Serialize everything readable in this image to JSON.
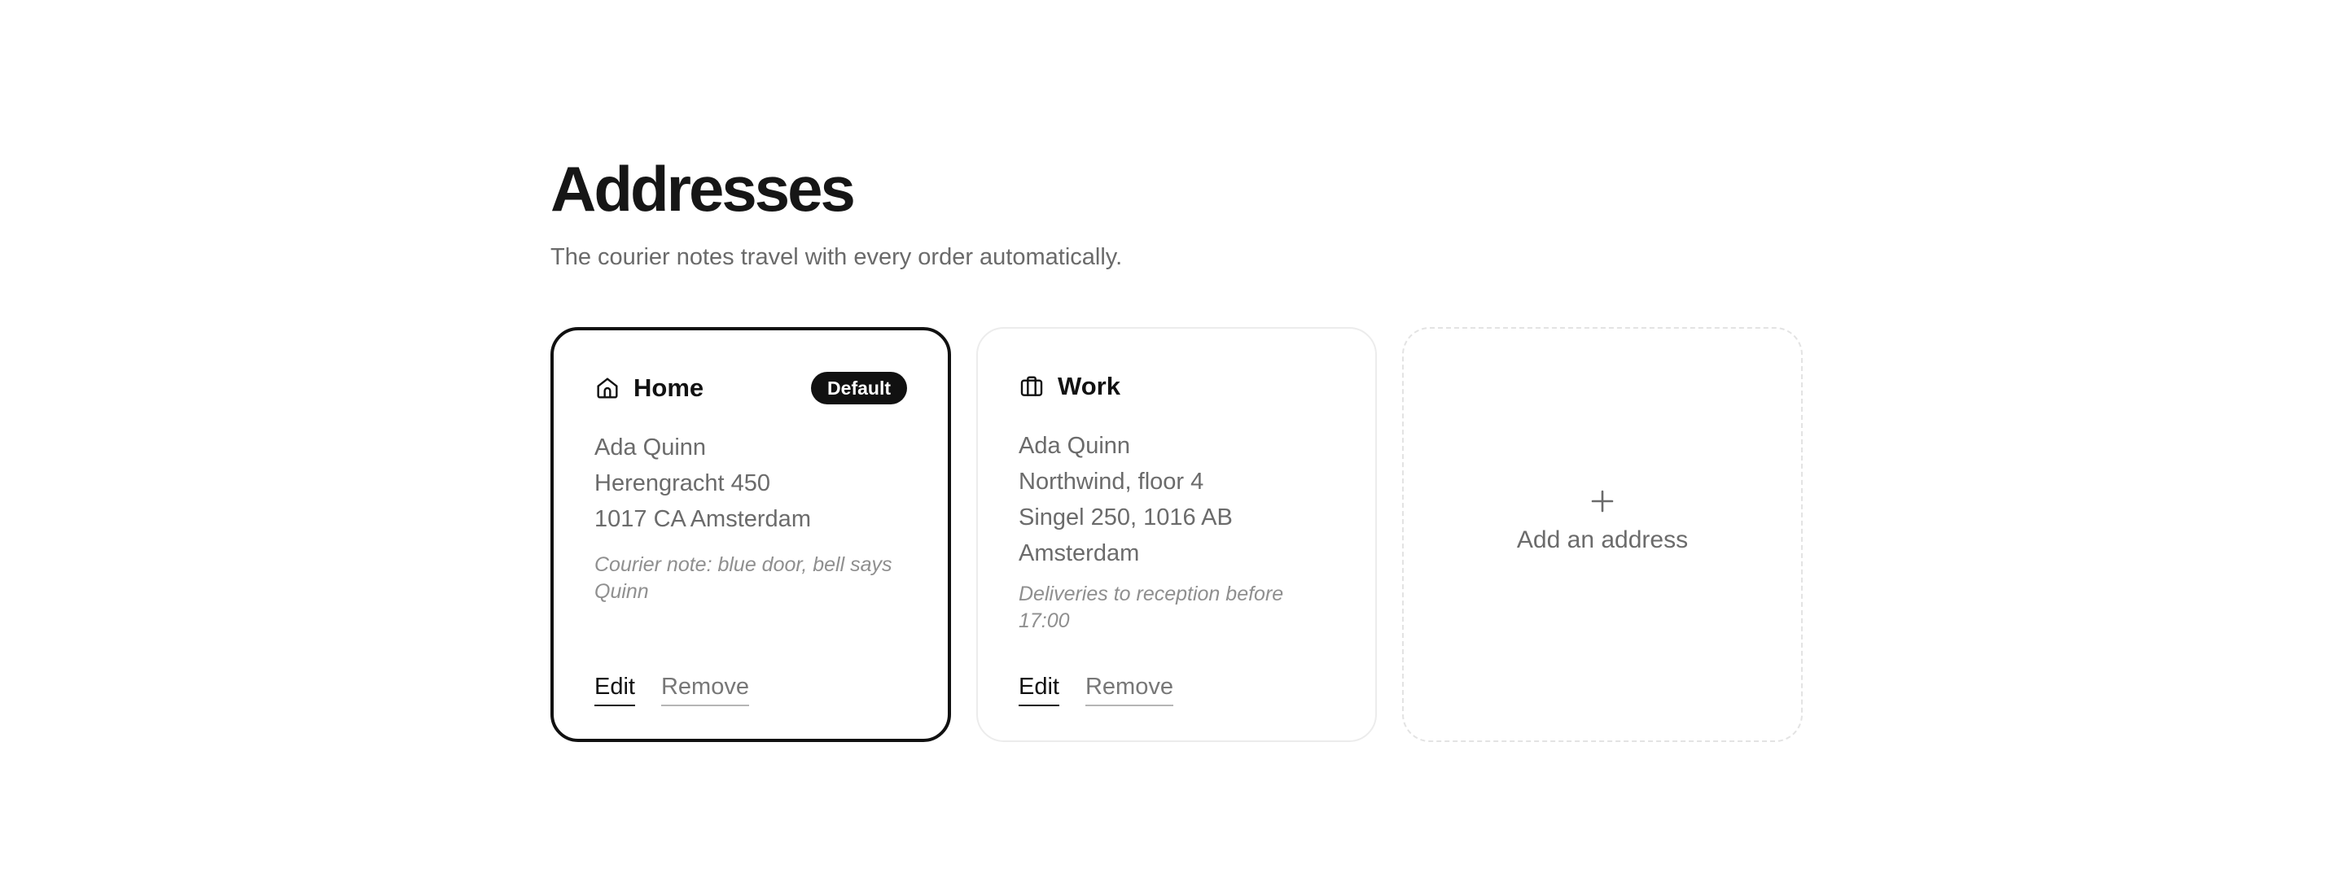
{
  "header": {
    "title": "Addresses",
    "subtitle": "The courier notes travel with every order automatically."
  },
  "cards": [
    {
      "title": "Home",
      "icon": "home-icon",
      "badge": "Default",
      "selected": true,
      "lines": [
        "Ada Quinn",
        "Herengracht 450",
        "1017 CA Amsterdam"
      ],
      "note": "Courier note: blue door, bell says Quinn",
      "edit_label": "Edit",
      "remove_label": "Remove"
    },
    {
      "title": "Work",
      "icon": "briefcase-icon",
      "selected": false,
      "lines": [
        "Ada Quinn",
        "Northwind, floor 4",
        "Singel 250, 1016 AB",
        "Amsterdam"
      ],
      "note": "Deliveries to reception before 17:00",
      "edit_label": "Edit",
      "remove_label": "Remove"
    }
  ],
  "add_card": {
    "icon": "plus-icon",
    "label": "Add an address"
  },
  "colors": {
    "text_primary": "#111111",
    "text_secondary": "#6b6b6b",
    "selected_border": "#111111",
    "card_border": "#ececec",
    "badge_bg": "#111111"
  }
}
